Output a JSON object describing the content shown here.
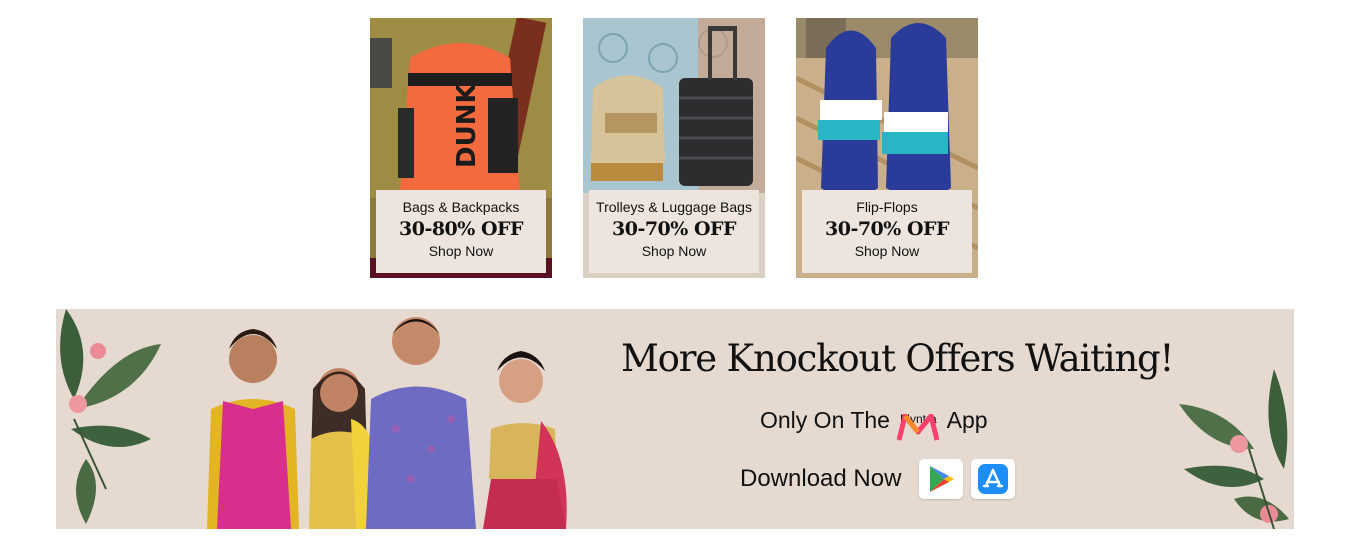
{
  "cards": [
    {
      "category": "Bags & Backpacks",
      "offer": "30-80% OFF",
      "cta": "Shop Now"
    },
    {
      "category": "Trolleys & Luggage Bags",
      "offer": "30-70% OFF",
      "cta": "Shop Now"
    },
    {
      "category": "Flip-Flops",
      "offer": "30-70% OFF",
      "cta": "Shop Now"
    }
  ],
  "banner": {
    "headline": "More Knockout Offers Waiting!",
    "only_on_prefix": "Only On The",
    "only_on_suffix": "App",
    "logo_text": "Myntra",
    "download_label": "Download Now"
  },
  "icons": [
    "play-store-icon",
    "app-store-icon",
    "myntra-logo-icon"
  ],
  "colors": {
    "card_info_bg": "#ede5dd",
    "banner_bg": "#e6dad0",
    "myntra_pink": "#ff3f6c",
    "myntra_orange": "#f98a29"
  }
}
